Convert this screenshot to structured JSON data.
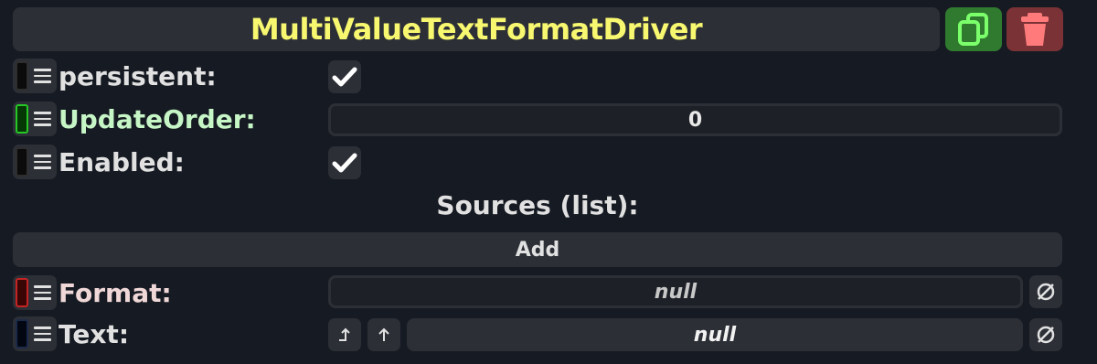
{
  "header": {
    "title": "MultiValueTextFormatDriver"
  },
  "fields": {
    "persistent": {
      "label": "persistent:",
      "checked": true
    },
    "update_order": {
      "label": "UpdateOrder:",
      "value": "0"
    },
    "enabled": {
      "label": "Enabled:",
      "checked": true
    },
    "sources": {
      "title": "Sources (list):",
      "add_label": "Add"
    },
    "format": {
      "label": "Format:",
      "value": "null"
    },
    "text": {
      "label": "Text:",
      "value": "null"
    }
  },
  "colors": {
    "title": "#f8f770",
    "update_order_label": "#c6f5c6",
    "format_label": "#f0d8d8",
    "duplicate_button": "#2f7a2f",
    "delete_button": "#7a3236"
  },
  "icons": {
    "duplicate": "copy-icon",
    "delete": "trash-icon",
    "check": "check-icon",
    "clear": "null-set-icon",
    "jump": "return-up-icon",
    "up": "arrow-up-icon"
  }
}
